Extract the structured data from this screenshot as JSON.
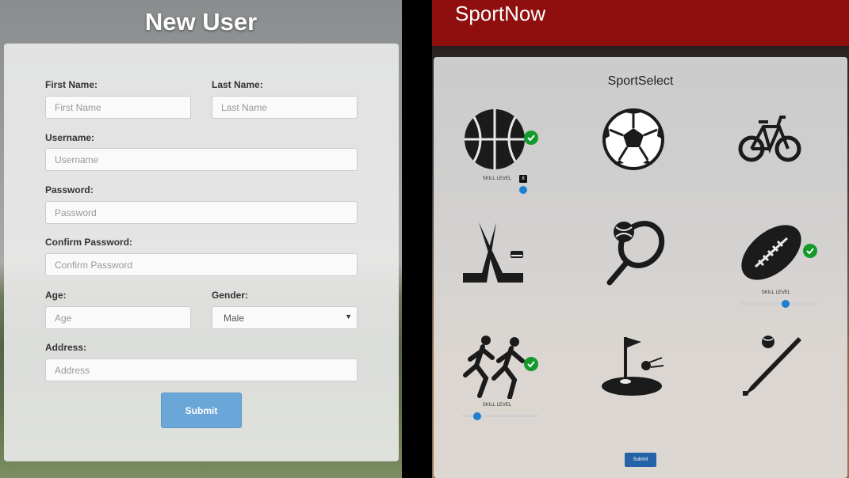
{
  "left": {
    "title": "New User",
    "fields": {
      "first_name": {
        "label": "First Name:",
        "placeholder": "First Name"
      },
      "last_name": {
        "label": "Last Name:",
        "placeholder": "Last Name"
      },
      "username": {
        "label": "Username:",
        "placeholder": "Username"
      },
      "password": {
        "label": "Password:",
        "placeholder": "Password"
      },
      "confirm_password": {
        "label": "Confirm Password:",
        "placeholder": "Confirm Password"
      },
      "age": {
        "label": "Age:",
        "placeholder": "Age"
      },
      "gender": {
        "label": "Gender:",
        "value": "Male"
      },
      "address": {
        "label": "Address:",
        "placeholder": "Address"
      }
    },
    "submit_label": "Submit"
  },
  "right": {
    "brand": "SportNow",
    "card_title": "SportSelect",
    "sports": [
      {
        "icon": "basketball-icon",
        "selected": true,
        "skill_label": "SKILL LEVEL",
        "skill_value": "8",
        "skill_fraction": 0.8
      },
      {
        "icon": "soccer-ball-icon",
        "selected": false
      },
      {
        "icon": "bicycle-icon",
        "selected": false
      },
      {
        "icon": "hockey-sticks-icon",
        "selected": false
      },
      {
        "icon": "tennis-racket-icon",
        "selected": false
      },
      {
        "icon": "football-icon",
        "selected": true,
        "skill_label": "SKILL LEVEL",
        "skill_fraction": 0.6
      },
      {
        "icon": "runners-icon",
        "selected": true,
        "skill_label": "SKILL LEVEL",
        "skill_fraction": 0.2
      },
      {
        "icon": "golf-icon",
        "selected": false
      },
      {
        "icon": "baseball-bat-icon",
        "selected": false
      }
    ],
    "submit_label": "Submit",
    "colors": {
      "header": "#8f0e0e",
      "check": "#139a2b",
      "slider": "#1f7ed0"
    }
  }
}
